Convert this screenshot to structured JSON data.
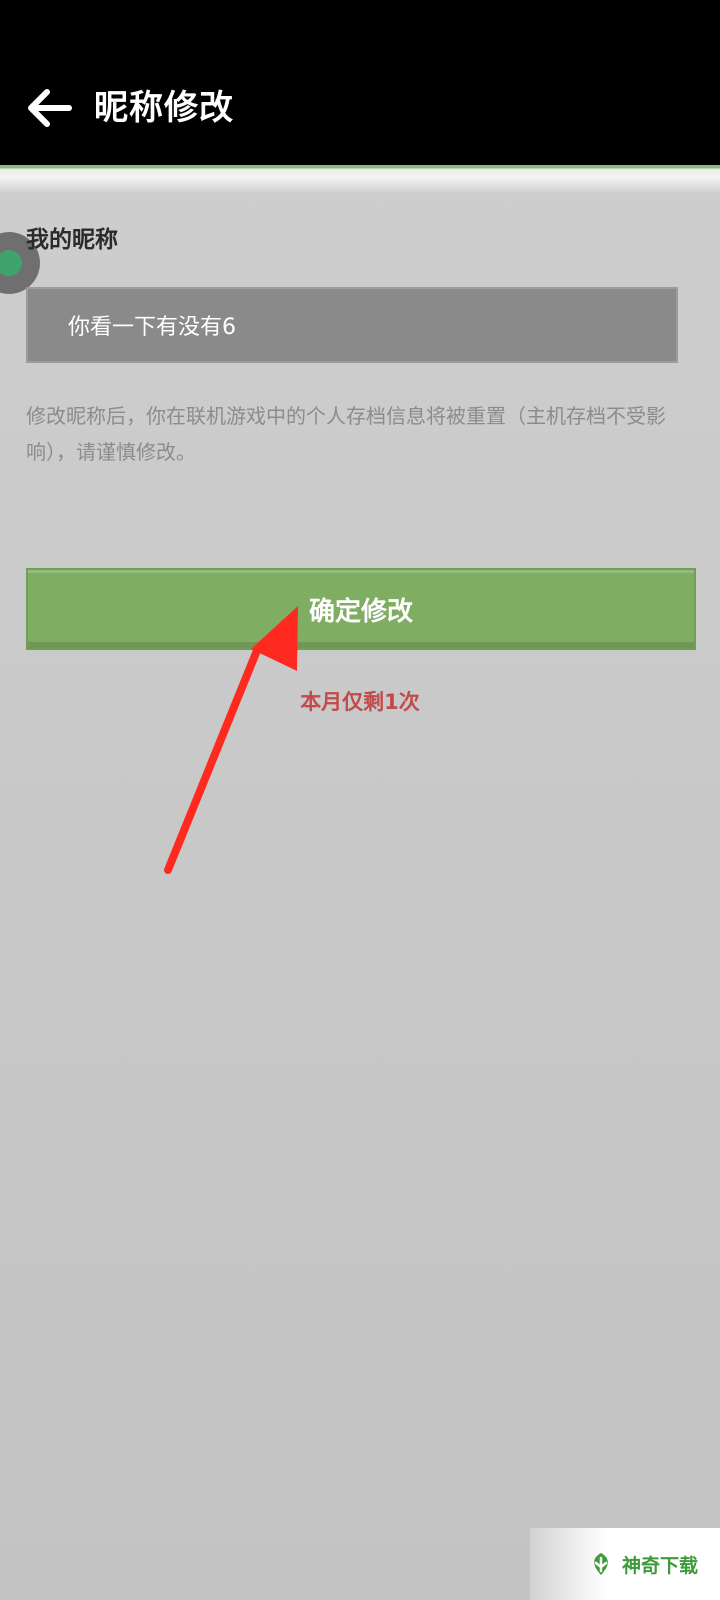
{
  "header": {
    "title": "昵称修改"
  },
  "form": {
    "label": "我的昵称",
    "nickname_value": "你看一下有没有6",
    "hint": "修改昵称后，你在联机游戏中的个人存档信息将被重置（主机存档不受影响），请谨慎修改。"
  },
  "actions": {
    "confirm_label": "确定修改",
    "remaining_note": "本月仅剩1次"
  },
  "watermark": {
    "text": "神奇下载"
  },
  "colors": {
    "topbar": "#000000",
    "confirm_button": "#7fad62",
    "remaining_note": "#c34a4a",
    "annotation_arrow": "#ff2a1f",
    "watermark_text": "#3e9b3b"
  }
}
